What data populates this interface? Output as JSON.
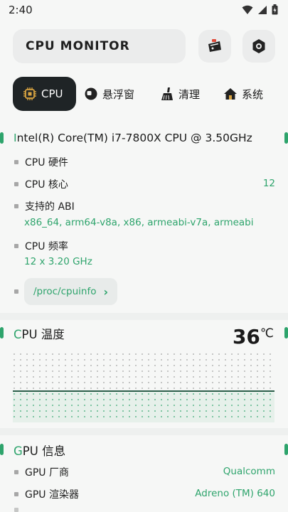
{
  "status_bar": {
    "time": "2:40"
  },
  "header": {
    "title": "CPU MONITOR"
  },
  "tabs": [
    {
      "label": "CPU",
      "icon": "cpu-chip-icon",
      "active": true
    },
    {
      "label": "悬浮窗",
      "icon": "floating-window-icon",
      "active": false
    },
    {
      "label": "清理",
      "icon": "broom-icon",
      "active": false
    },
    {
      "label": "系统",
      "icon": "home-icon",
      "active": false
    }
  ],
  "cpu": {
    "name_first": "I",
    "name_rest": "ntel(R) Core(TM) i7-7800X CPU @ 3.50GHz",
    "hardware_label": "CPU 硬件",
    "cores_label": "CPU 核心",
    "cores_value": "12",
    "abi_label": "支持的 ABI",
    "abi_value": "x86_64, arm64-v8a, x86, armeabi-v7a, armeabi",
    "freq_label": "CPU 频率",
    "freq_value": "12 x 3.20 GHz",
    "cpuinfo_link": "/proc/cpuinfo",
    "chevron": "›"
  },
  "temperature": {
    "title_first": "C",
    "title_rest": "PU 温度",
    "value": "36",
    "unit": "℃",
    "color": "#2ea46c"
  },
  "gpu": {
    "title_first": "G",
    "title_rest": "PU 信息",
    "vendor_label": "GPU 厂商",
    "vendor_value": "Qualcomm",
    "renderer_label": "GPU 渲染器",
    "renderer_value": "Adreno (TM) 640"
  },
  "accent_color": "#2ea46c"
}
